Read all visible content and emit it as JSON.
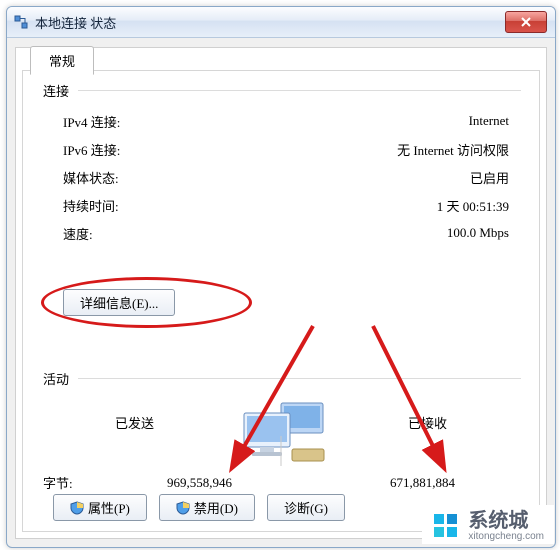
{
  "window": {
    "title": "本地连接 状态"
  },
  "tab": {
    "label": "常规"
  },
  "group_connect": {
    "label": "连接"
  },
  "rows": {
    "ipv4": {
      "label": "IPv4 连接:",
      "value": "Internet"
    },
    "ipv6": {
      "label": "IPv6 连接:",
      "value": "无 Internet 访问权限"
    },
    "media": {
      "label": "媒体状态:",
      "value": "已启用"
    },
    "duration": {
      "label": "持续时间:",
      "value": "1 天 00:51:39"
    },
    "speed": {
      "label": "速度:",
      "value": "100.0 Mbps"
    }
  },
  "details_button": "详细信息(E)...",
  "group_activity": {
    "label": "活动",
    "sent_label": "已发送",
    "recv_label": "已接收",
    "bytes_label": "字节:",
    "sent": "969,558,946",
    "recv": "671,881,884"
  },
  "buttons": {
    "properties": "属性(P)",
    "disable": "禁用(D)",
    "diagnose": "诊断(G)"
  },
  "watermark": {
    "brand": "系统城",
    "url": "xitongcheng.com"
  }
}
